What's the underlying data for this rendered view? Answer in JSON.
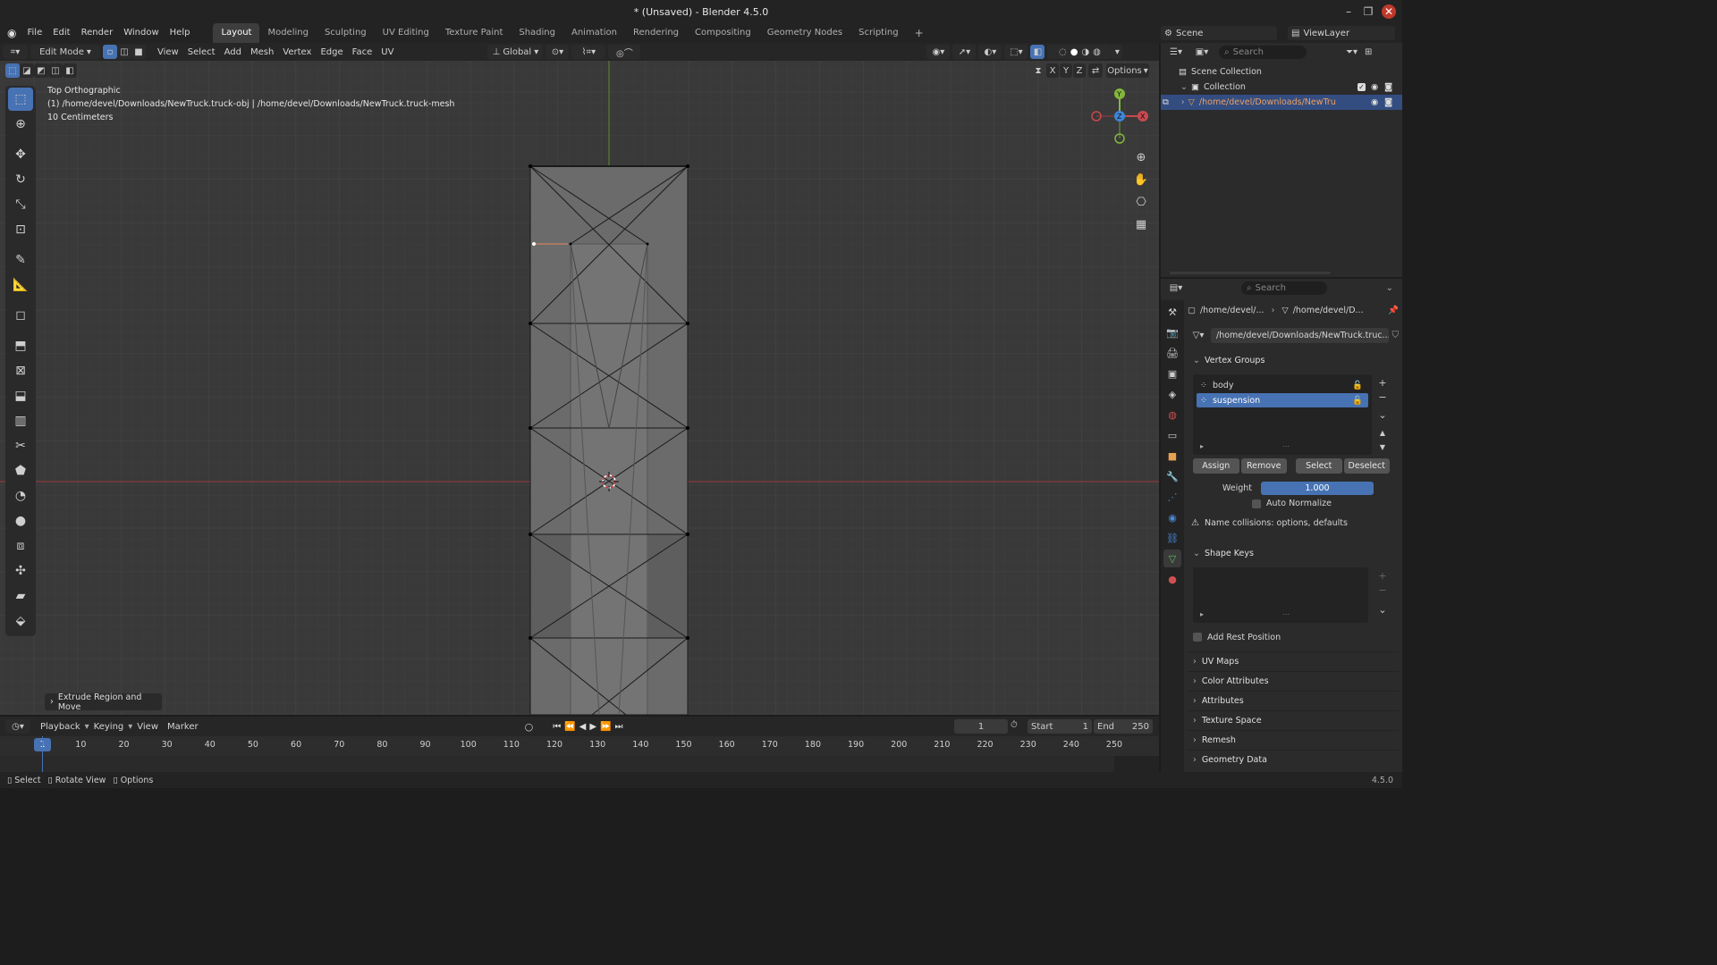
{
  "window": {
    "title": "* (Unsaved) - Blender 4.5.0",
    "minimize": "–",
    "maximize": "❐",
    "close": "✕"
  },
  "menus": [
    "File",
    "Edit",
    "Render",
    "Window",
    "Help"
  ],
  "workspaces": [
    "Layout",
    "Modeling",
    "Sculpting",
    "UV Editing",
    "Texture Paint",
    "Shading",
    "Animation",
    "Rendering",
    "Compositing",
    "Geometry Nodes",
    "Scripting"
  ],
  "workspace_add": "+",
  "scene": {
    "label": "Scene",
    "viewlayer": "ViewLayer"
  },
  "viewport_header": {
    "mode": "Edit Mode",
    "menus": [
      "View",
      "Select",
      "Add",
      "Mesh",
      "Vertex",
      "Edge",
      "Face",
      "UV"
    ],
    "transform_orientation": "Global",
    "options": "Options",
    "axes": [
      "X",
      "Y",
      "Z"
    ]
  },
  "viewport_info": {
    "view_name": "Top Orthographic",
    "object_line": "(1) /home/devel/Downloads/NewTruck.truck-obj | /home/devel/Downloads/NewTruck.truck-mesh",
    "scale": "10 Centimeters"
  },
  "gizmo": {
    "y": "Y",
    "x": "X",
    "z": "Z"
  },
  "last_operator": "Extrude Region and Move",
  "timeline": {
    "menus": [
      "Playback",
      "Keying",
      "View",
      "Marker"
    ],
    "current_frame": "1",
    "start_label": "Start",
    "start": "1",
    "end_label": "End",
    "end": "250",
    "ticks": [
      "1",
      "10",
      "20",
      "30",
      "40",
      "50",
      "60",
      "70",
      "80",
      "90",
      "100",
      "110",
      "120",
      "130",
      "140",
      "150",
      "160",
      "170",
      "180",
      "190",
      "200",
      "210",
      "220",
      "230",
      "240",
      "250"
    ]
  },
  "statusbar": {
    "select": "Select",
    "rotate": "Rotate View",
    "options": "Options",
    "version": "4.5.0"
  },
  "outliner": {
    "search_placeholder": "Search",
    "scene_collection": "Scene Collection",
    "collection": "Collection",
    "object": "/home/devel/Downloads/NewTru"
  },
  "properties": {
    "search_placeholder": "Search",
    "breadcrumb_object": "/home/devel/...",
    "breadcrumb_data": "/home/devel/D...",
    "mesh_name": "/home/devel/Downloads/NewTruck.truc...",
    "vertex_groups_title": "Vertex Groups",
    "vertex_groups": [
      "body",
      "suspension"
    ],
    "assign": "Assign",
    "remove": "Remove",
    "select": "Select",
    "deselect": "Deselect",
    "weight_label": "Weight",
    "weight_value": "1.000",
    "auto_normalize": "Auto Normalize",
    "warning": "Name collisions: options, defaults",
    "shape_keys_title": "Shape Keys",
    "add_rest_position": "Add Rest Position",
    "sections": [
      "UV Maps",
      "Color Attributes",
      "Attributes",
      "Texture Space",
      "Remesh",
      "Geometry Data"
    ]
  },
  "colors": {
    "accent": "#4772b3",
    "x_axis": "#c94950",
    "y_axis": "#83b63b",
    "z_axis": "#3e86d9"
  }
}
